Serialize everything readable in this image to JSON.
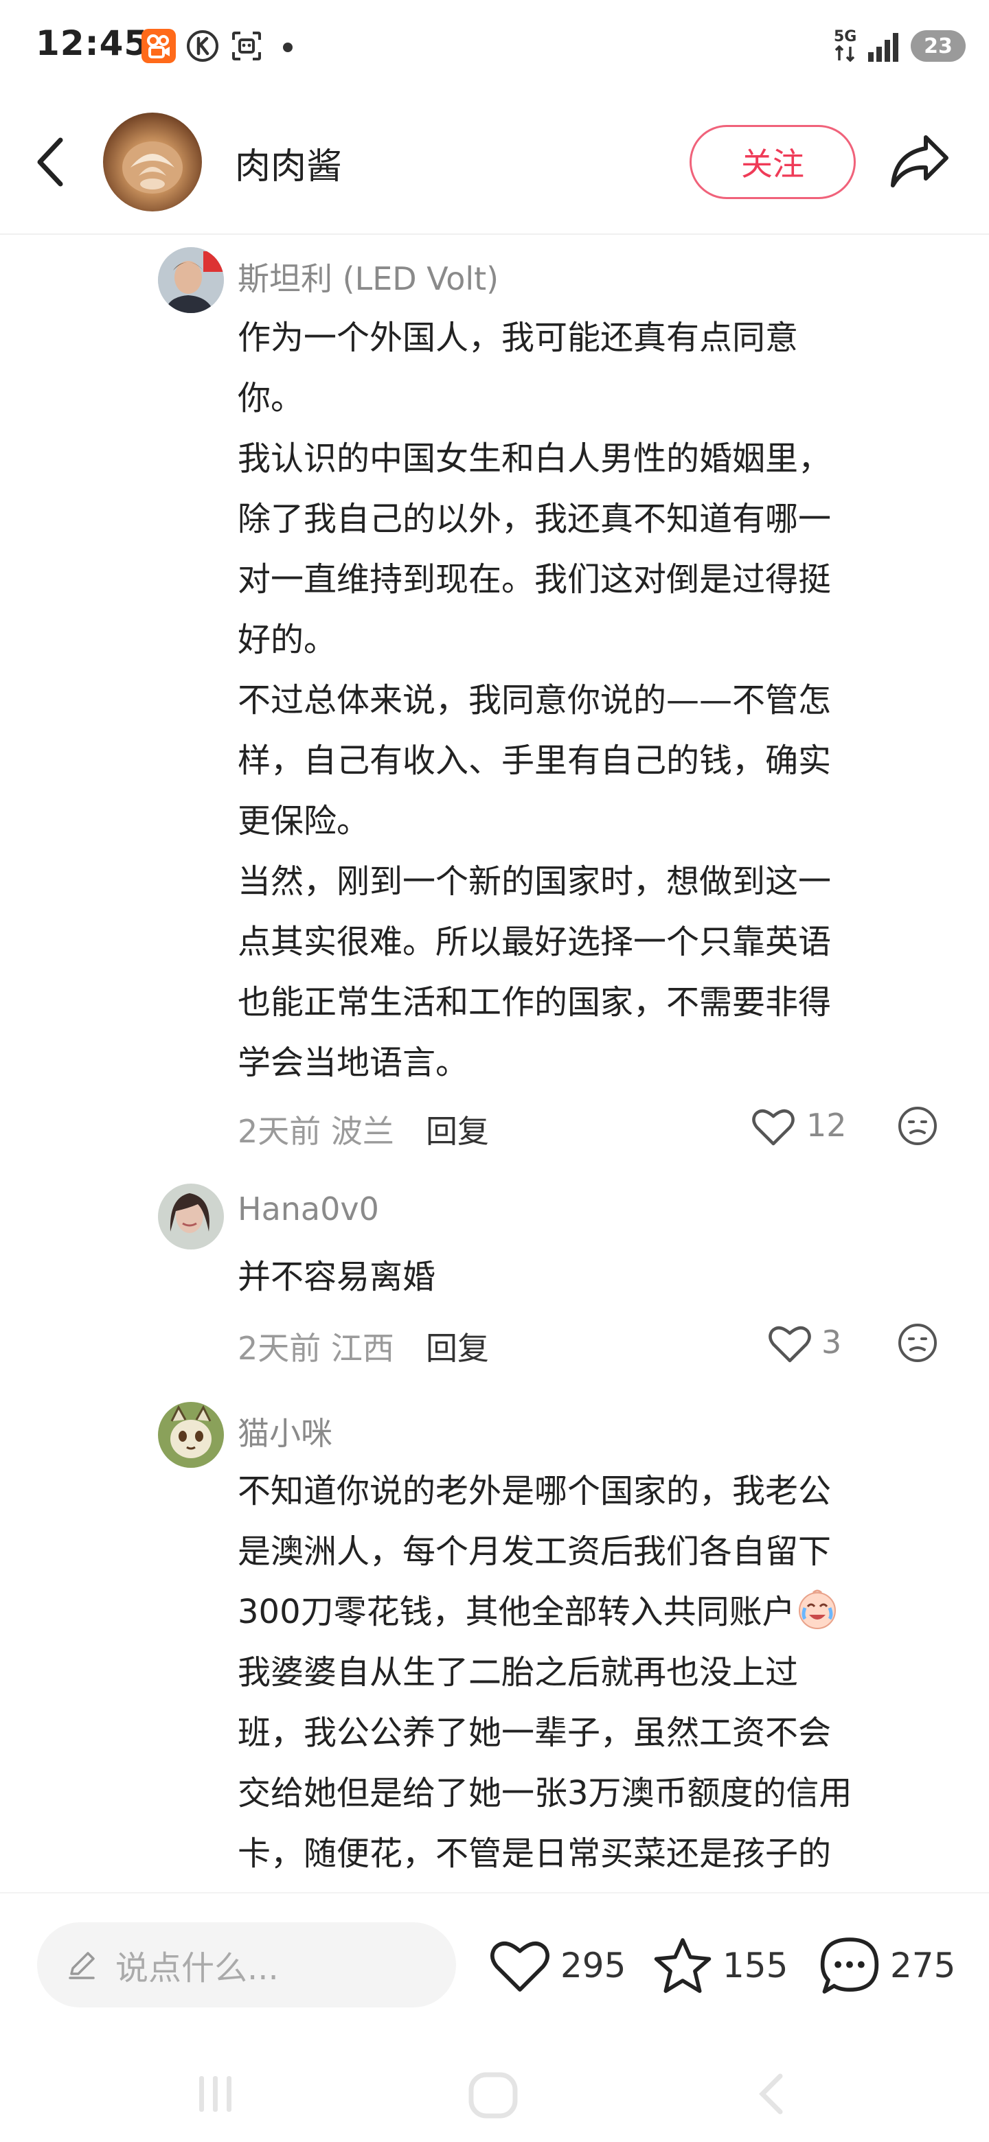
{
  "status_bar": {
    "time": "12:45",
    "network": "5G",
    "battery": "23"
  },
  "header": {
    "author": "肉肉酱",
    "follow_label": "关注"
  },
  "comments": [
    {
      "name": "斯坦利 (LED Volt)",
      "lines": [
        "作为一个外国人，我可能还真有点同意",
        "你。",
        "我认识的中国女生和白人男性的婚姻里，",
        "除了我自己的以外，我还真不知道有哪一",
        "对一直维持到现在。我们这对倒是过得挺",
        "好的。",
        "不过总体来说，我同意你说的——不管怎",
        "样，自己有收入、手里有自己的钱，确实",
        "更保险。",
        "当然，刚到一个新的国家时，想做到这一",
        "点其实很难。所以最好选择一个只靠英语",
        "也能正常生活和工作的国家，不需要非得",
        "学会当地语言。"
      ],
      "time_loc": "2天前 波兰",
      "reply_label": "回复",
      "likes": "12"
    },
    {
      "name": "Hana0v0",
      "lines": [
        "并不容易离婚"
      ],
      "time_loc": "2天前 江西",
      "reply_label": "回复",
      "likes": "3"
    },
    {
      "name": "猫小咪",
      "lines": [
        "不知道你说的老外是哪个国家的，我老公",
        "是澳洲人，每个月发工资后我们各自留下",
        "300刀零花钱，其他全部转入共同账户",
        "我婆婆自从生了二胎之后就再也没上过",
        "班，我公公养了她一辈子，虽然工资不会",
        "交给她但是给了她一张3万澳币额度的信用",
        "卡，随便花，不管是日常买菜还是孩子的"
      ]
    }
  ],
  "bottom_bar": {
    "input_placeholder": "说点什么...",
    "likes": "295",
    "favorites": "155",
    "comments": "275"
  },
  "colors": {
    "accent": "#ef3b57",
    "text": "#222222",
    "secondary": "#8a8a8a"
  }
}
